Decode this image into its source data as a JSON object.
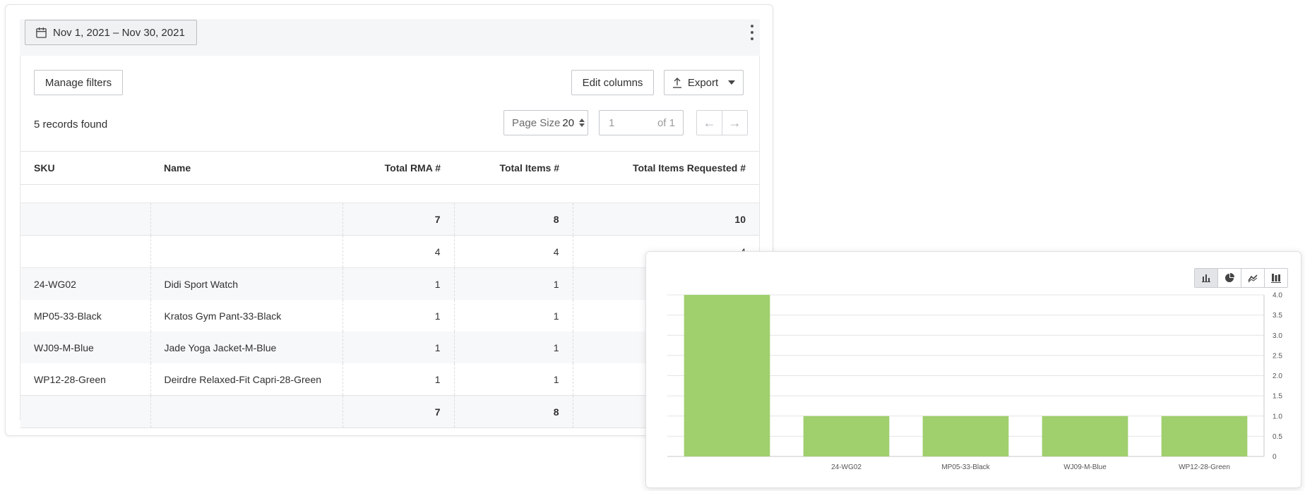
{
  "report": {
    "date_range": "Nov 1, 2021 – Nov 30, 2021",
    "manage_filters": "Manage filters",
    "edit_columns": "Edit columns",
    "export": "Export",
    "records_found": "5 records found",
    "page_size_label": "Page Size",
    "page_size_value": "20",
    "page_current": "1",
    "page_of": "of 1",
    "prev_arrow": "←",
    "next_arrow": "→"
  },
  "table": {
    "columns": [
      "SKU",
      "Name",
      "Total RMA #",
      "Total Items #",
      "Total Items Requested #"
    ],
    "top_total": [
      "",
      "",
      "7",
      "8",
      "10"
    ],
    "subtotal": [
      "",
      "",
      "4",
      "4",
      "4"
    ],
    "rows": [
      [
        "24-WG02",
        "Didi Sport Watch",
        "1",
        "1",
        ""
      ],
      [
        "MP05-33-Black",
        "Kratos Gym Pant-33-Black",
        "1",
        "1",
        ""
      ],
      [
        "WJ09-M-Blue",
        "Jade Yoga Jacket-M-Blue",
        "1",
        "1",
        ""
      ],
      [
        "WP12-28-Green",
        "Deirdre Relaxed-Fit Capri-28-Green",
        "1",
        "1",
        ""
      ]
    ],
    "bottom_total": [
      "",
      "",
      "7",
      "8",
      ""
    ]
  },
  "chart_toolbar": [
    "bar-chart-icon",
    "pie-chart-icon",
    "line-chart-icon",
    "stacked-bar-icon"
  ],
  "chart_data": {
    "type": "bar",
    "categories": [
      "",
      "24-WG02",
      "MP05-33-Black",
      "WJ09-M-Blue",
      "WP12-28-Green"
    ],
    "values": [
      4,
      1,
      1,
      1,
      1
    ],
    "ylim": [
      0,
      4
    ],
    "yticks": [
      "0",
      "0.5",
      "1.0",
      "1.5",
      "2.0",
      "2.5",
      "3.0",
      "3.5",
      "4.0"
    ],
    "grid": true,
    "color": "#a0cf6e"
  }
}
